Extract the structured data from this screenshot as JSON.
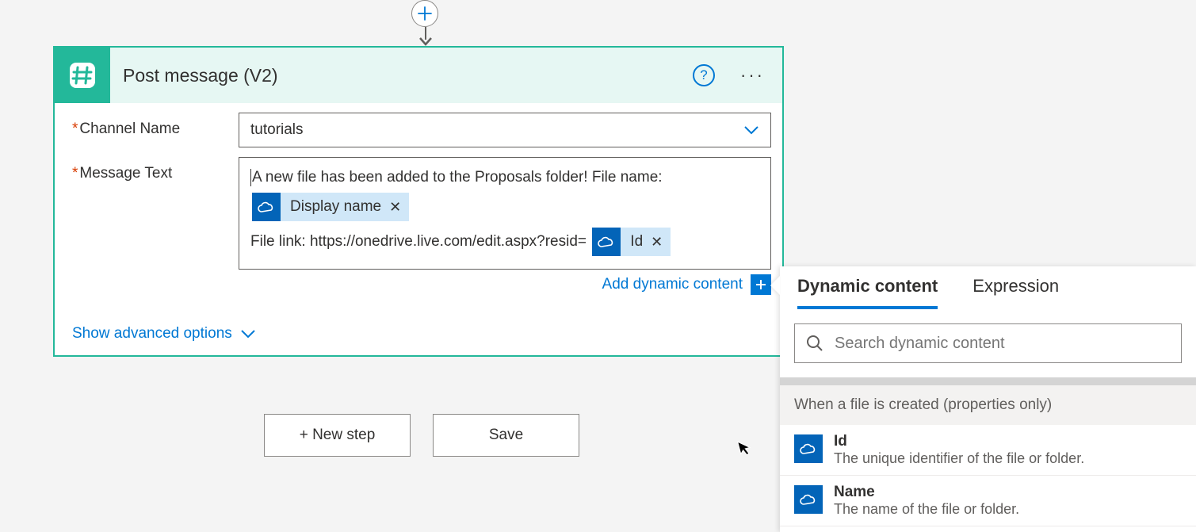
{
  "card": {
    "title": "Post message (V2)",
    "fields": {
      "channel": {
        "label": "Channel Name",
        "value": "tutorials"
      },
      "message": {
        "label": "Message Text",
        "text_prefix": "A new file has been added to the Proposals folder!  File name:",
        "token1": "Display name",
        "text_mid": "File link: https://onedrive.live.com/edit.aspx?resid=",
        "token2": "Id"
      }
    },
    "add_dynamic": "Add dynamic content",
    "advanced": "Show advanced options"
  },
  "buttons": {
    "new_step": "+ New step",
    "save": "Save"
  },
  "dyn_panel": {
    "tabs": {
      "content": "Dynamic content",
      "expression": "Expression"
    },
    "search_placeholder": "Search dynamic content",
    "group": "When a file is created (properties only)",
    "items": [
      {
        "title": "Id",
        "desc": "The unique identifier of the file or folder."
      },
      {
        "title": "Name",
        "desc": "The name of the file or folder."
      }
    ]
  }
}
